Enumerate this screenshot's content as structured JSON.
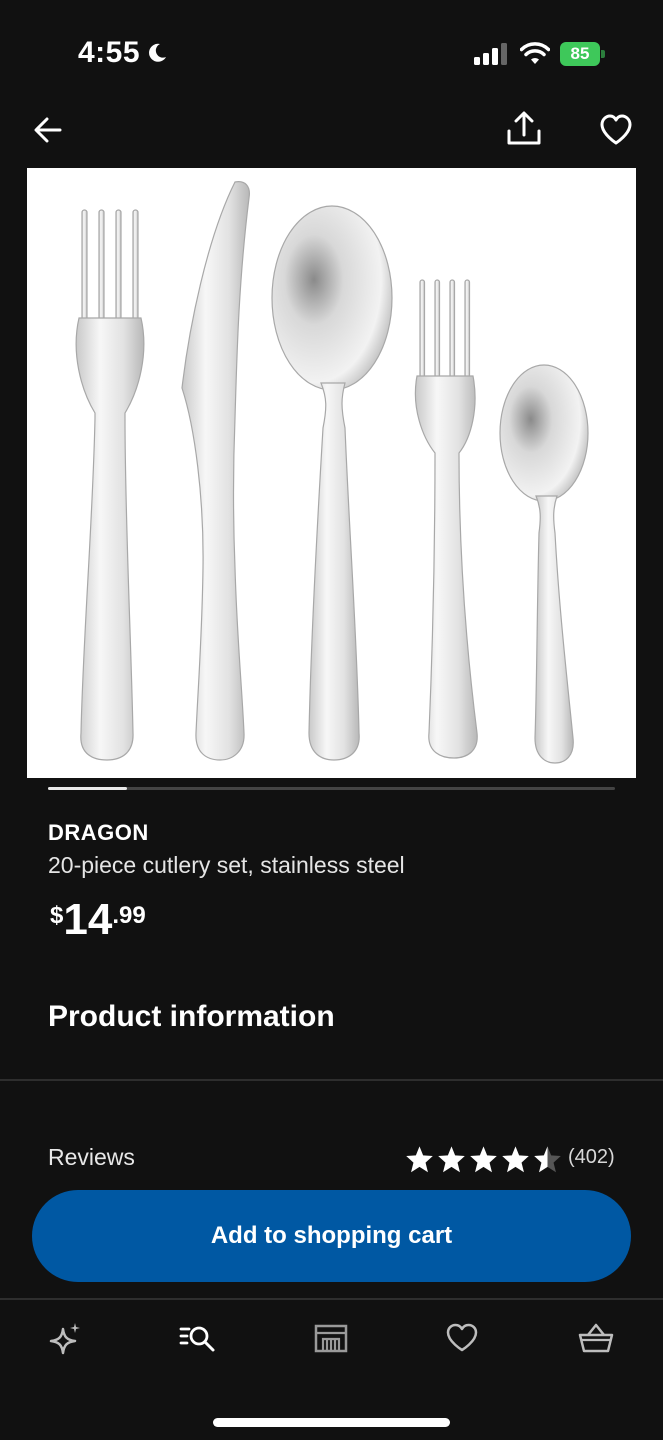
{
  "status_bar": {
    "time": "4:55",
    "battery": "85",
    "battery_color": "#3ec85a"
  },
  "header": {
    "icons": [
      "back-arrow-icon",
      "share-icon",
      "heart-icon"
    ]
  },
  "product": {
    "brand": "DRAGON",
    "description": "20-piece cutlery set, stainless steel",
    "price_currency": "$",
    "price_whole": "14",
    "price_cents": ".99",
    "carousel_position": 1
  },
  "sections": {
    "product_information": "Product information"
  },
  "reviews": {
    "label": "Reviews",
    "rating": 4.5,
    "max_rating": 5,
    "count": "(402)"
  },
  "actions": {
    "add_to_cart": "Add to shopping cart",
    "accent_color": "#0058a3"
  },
  "tab_bar": {
    "items": [
      "sparkle-icon",
      "search-list-icon",
      "store-icon",
      "heart-icon",
      "basket-icon"
    ]
  }
}
